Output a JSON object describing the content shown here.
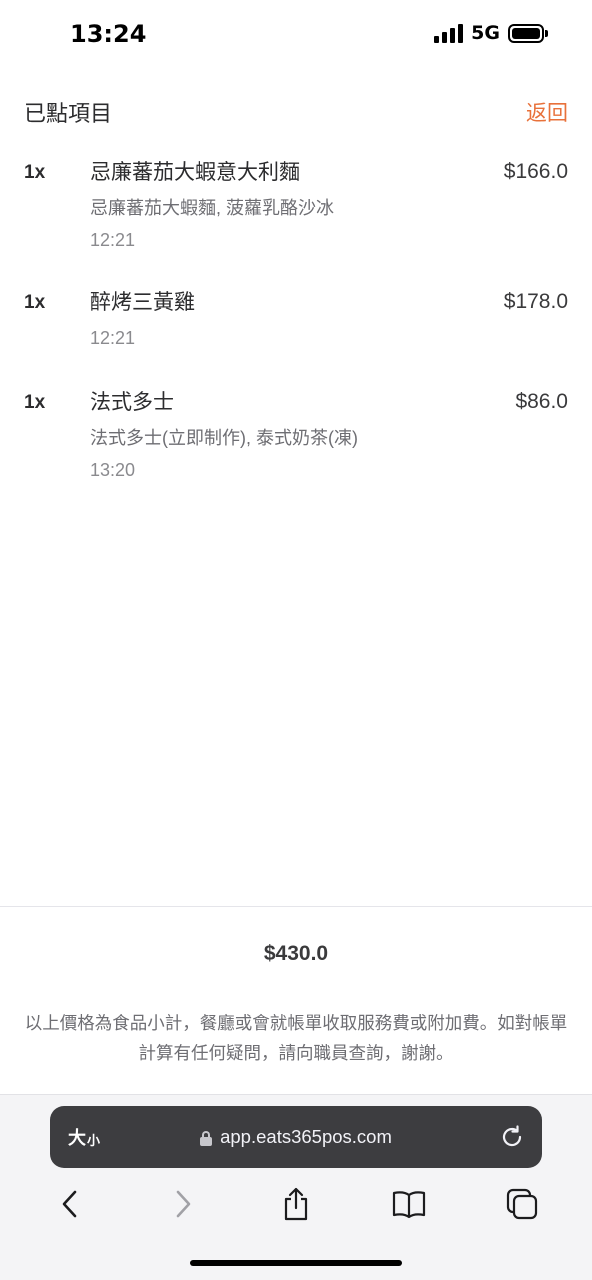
{
  "status_bar": {
    "time": "13:24",
    "network": "5G"
  },
  "header": {
    "title": "已點項目",
    "back_label": "返回",
    "accent_color": "#e8713a"
  },
  "items": [
    {
      "qty": "1x",
      "name": "忌廉蕃茄大蝦意大利麵",
      "price": "$166.0",
      "description": "忌廉蕃茄大蝦麵, 菠蘿乳酪沙冰",
      "time": "12:21"
    },
    {
      "qty": "1x",
      "name": "醉烤三黃雞",
      "price": "$178.0",
      "description": "",
      "time": "12:21"
    },
    {
      "qty": "1x",
      "name": "法式多士",
      "price": "$86.0",
      "description": "法式多士(立即制作), 泰式奶茶(凍)",
      "time": "13:20"
    }
  ],
  "summary": {
    "total": "$430.0",
    "note": "以上價格為食品小計，餐廳或會就帳單收取服務費或附加費。如對帳單計算有任何疑問，請向職員查詢，謝謝。"
  },
  "browser": {
    "text_size_big": "大",
    "text_size_small": "小",
    "url": "app.eats365pos.com",
    "icons": [
      "lock-icon",
      "reload-icon",
      "back-icon",
      "forward-icon",
      "share-icon",
      "bookmarks-icon",
      "tabs-icon"
    ]
  }
}
